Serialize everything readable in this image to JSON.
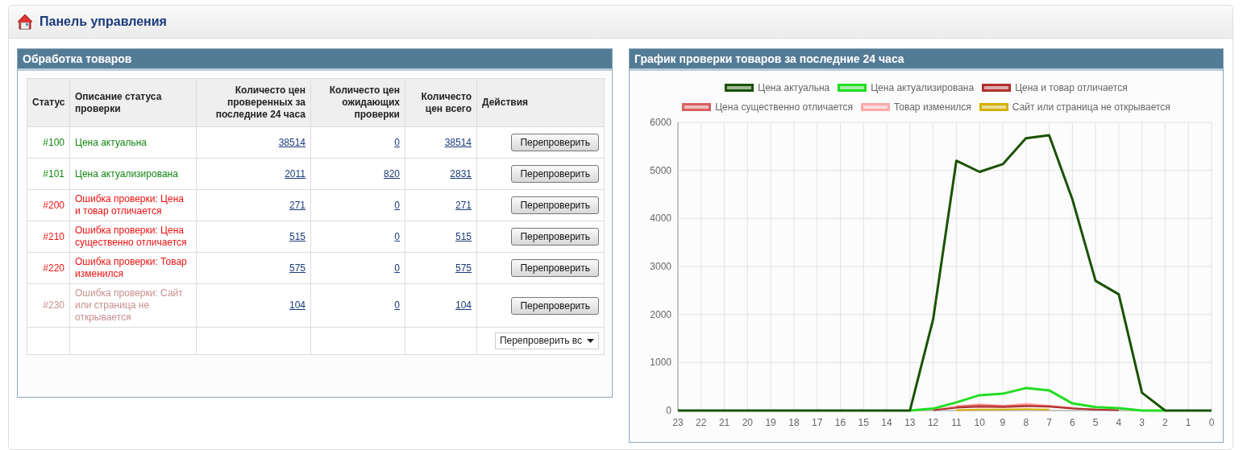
{
  "page": {
    "title": "Панель управления"
  },
  "processing": {
    "title": "Обработка товаров",
    "columns": [
      "Статус",
      "Описание статуса проверки",
      "Количесто цен проверенных за последние 24 часа",
      "Количесто цен ожидающих проверки",
      "Количесто цен всего",
      "Действия"
    ],
    "rows": [
      {
        "status": "#100",
        "kind": "ok",
        "description": "Цена актуальна",
        "checked_24h": "38514",
        "pending": "0",
        "total": "38514",
        "action": "Перепроверить"
      },
      {
        "status": "#101",
        "kind": "ok",
        "description": "Цена актуализирована",
        "checked_24h": "2011",
        "pending": "820",
        "total": "2831",
        "action": "Перепроверить"
      },
      {
        "status": "#200",
        "kind": "error",
        "description": "Ошибка проверки: Цена и товар отличается",
        "checked_24h": "271",
        "pending": "0",
        "total": "271",
        "action": "Перепроверить"
      },
      {
        "status": "#210",
        "kind": "error",
        "description": "Ошибка проверки: Цена существенно отличается",
        "checked_24h": "515",
        "pending": "0",
        "total": "515",
        "action": "Перепроверить"
      },
      {
        "status": "#220",
        "kind": "error",
        "description": "Ошибка проверки: Товар изменился",
        "checked_24h": "575",
        "pending": "0",
        "total": "575",
        "action": "Перепроверить"
      },
      {
        "status": "#230",
        "kind": "warning",
        "description": "Ошибка проверки: Сайт или страница не открывается",
        "checked_24h": "104",
        "pending": "0",
        "total": "104",
        "action": "Перепроверить"
      }
    ],
    "bulk_action": "Перепроверить вс"
  },
  "chart_panel": {
    "title": "График проверки товаров за последние 24 часа",
    "chart_data": {
      "type": "line",
      "grid": true,
      "legend": true,
      "categories": [
        "23",
        "22",
        "21",
        "20",
        "19",
        "18",
        "17",
        "16",
        "15",
        "14",
        "13",
        "12",
        "11",
        "10",
        "9",
        "8",
        "7",
        "6",
        "5",
        "4",
        "3",
        "2",
        "1",
        "0"
      ],
      "ylim": [
        0,
        6000
      ],
      "yticks": [
        0,
        1000,
        2000,
        3000,
        4000,
        5000,
        6000
      ],
      "series": [
        {
          "name": "Цена актуальна",
          "color": "#1a5200",
          "values": [
            0,
            0,
            0,
            0,
            0,
            0,
            0,
            0,
            0,
            0,
            0,
            1900,
            5200,
            4970,
            5130,
            5670,
            5730,
            4400,
            2700,
            2420,
            370,
            0,
            0,
            0
          ]
        },
        {
          "name": "Цена актуализирована",
          "color": "#22dd22",
          "values": [
            null,
            null,
            null,
            null,
            null,
            null,
            null,
            null,
            null,
            null,
            0,
            40,
            170,
            320,
            350,
            470,
            420,
            150,
            70,
            50,
            0,
            0,
            null,
            null
          ]
        },
        {
          "name": "Цена и товар отличается",
          "color": "#b03030",
          "values": [
            null,
            null,
            null,
            null,
            null,
            null,
            null,
            null,
            null,
            null,
            null,
            10,
            60,
            80,
            70,
            90,
            80,
            40,
            20,
            10,
            null,
            null,
            null,
            null
          ]
        },
        {
          "name": "Цена существенно отличается",
          "color": "#d86060",
          "values": [
            null,
            null,
            null,
            null,
            null,
            null,
            null,
            null,
            null,
            null,
            null,
            null,
            80,
            110,
            90,
            110,
            90,
            50,
            20,
            null,
            null,
            null,
            null,
            null
          ]
        },
        {
          "name": "Товар изменился",
          "color": "#ffaaaa",
          "values": [
            null,
            null,
            null,
            null,
            null,
            null,
            null,
            null,
            null,
            null,
            null,
            10,
            90,
            130,
            100,
            140,
            100,
            60,
            null,
            null,
            null,
            null,
            null,
            null
          ]
        },
        {
          "name": "Сайт или страница не открывается",
          "color": "#d4b000",
          "values": [
            null,
            null,
            null,
            null,
            null,
            null,
            null,
            null,
            null,
            null,
            null,
            null,
            10,
            20,
            20,
            30,
            20,
            null,
            null,
            null,
            null,
            null,
            null,
            null
          ]
        }
      ]
    }
  }
}
